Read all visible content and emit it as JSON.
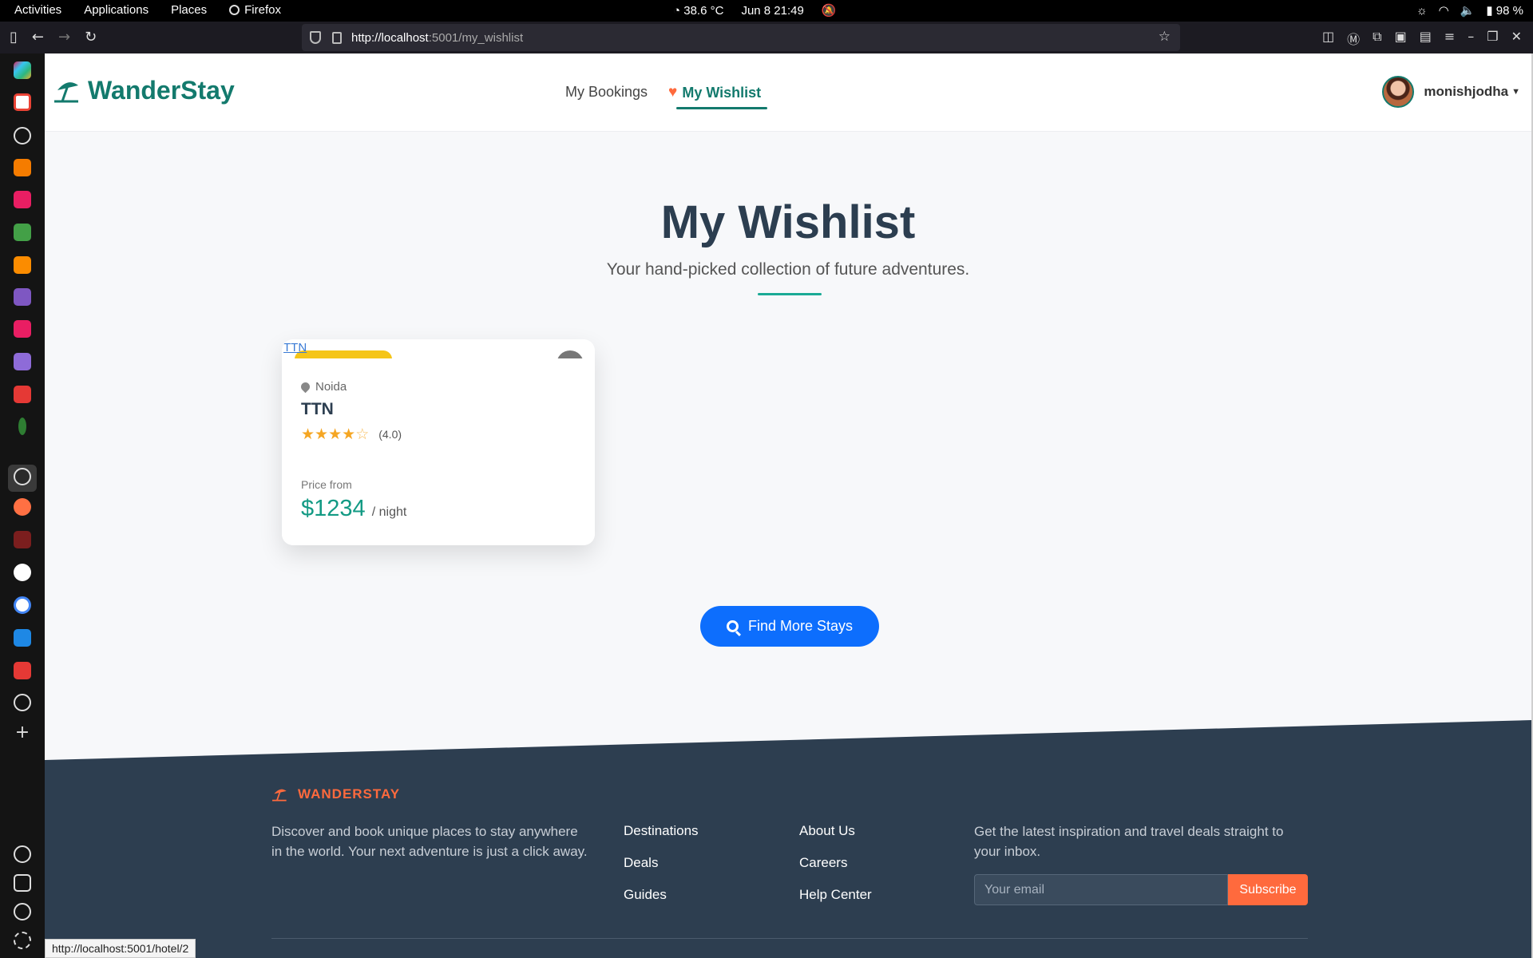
{
  "system": {
    "activities": "Activities",
    "applications": "Applications",
    "places": "Places",
    "browser": "Firefox",
    "temperature": "38.6 °C",
    "datetime": "Jun 8  21:49",
    "battery": "98 %"
  },
  "browser": {
    "url_host": "http://localhost",
    "url_rest": ":5001/my_wishlist",
    "status_url": "http://localhost:5001/hotel/2"
  },
  "header": {
    "brand": "WanderStay",
    "nav": {
      "bookings": "My Bookings",
      "wishlist": "My Wishlist"
    },
    "username": "monishjodha"
  },
  "hero": {
    "title": "My Wishlist",
    "subtitle": "Your hand-picked collection of future adventures."
  },
  "card": {
    "image_alt": "TTN",
    "location": "Noida",
    "name": "TTN",
    "rating": 4,
    "rating_text": "(4.0)",
    "price_label": "Price from",
    "price": "$1234",
    "per_night": "/ night"
  },
  "cta": {
    "label": "Find More Stays"
  },
  "footer": {
    "brand": "WANDERSTAY",
    "about": "Discover and book unique places to stay anywhere in the world. Your next adventure is just a click away.",
    "col1": [
      "Destinations",
      "Deals",
      "Guides"
    ],
    "col2": [
      "About Us",
      "Careers",
      "Help Center"
    ],
    "newsletter": "Get the latest inspiration and travel deals straight to your inbox.",
    "email_placeholder": "Your email",
    "subscribe": "Subscribe"
  },
  "colors": {
    "brand": "#137a6d",
    "accent": "#ff6a3d",
    "cta": "#0d6efd",
    "footer": "#2d3e50",
    "star": "#f5a623"
  }
}
